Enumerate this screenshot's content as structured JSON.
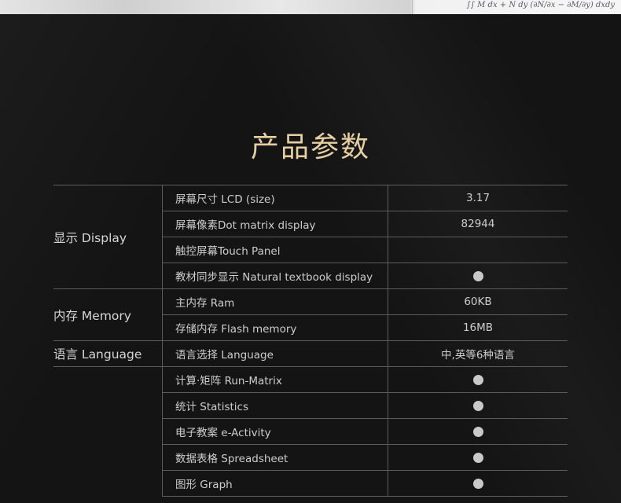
{
  "header_strip": {
    "scribble": "$\\frac{}{}M_{dx}+N dy \\int\\int(\\frac{\\partial N}{\\partial x}-\\frac{\\partial M}{\\partial y})dxdy$"
  },
  "page_title": "产品参数",
  "spec_table": {
    "groups": [
      {
        "category": "显示 Display",
        "rows": [
          {
            "name": "屏幕尺寸 LCD (size)",
            "value": "3.17",
            "dot": false
          },
          {
            "name": "屏幕像素Dot matrix display",
            "value": "82944",
            "dot": false
          },
          {
            "name": "触控屏幕Touch Panel",
            "value": "",
            "dot": false
          },
          {
            "name": "教材同步显示 Natural textbook display",
            "value": "",
            "dot": true
          }
        ]
      },
      {
        "category": "内存 Memory",
        "rows": [
          {
            "name": "主内存 Ram",
            "value": "60KB",
            "dot": false
          },
          {
            "name": "存储内存 Flash  memory",
            "value": "16MB",
            "dot": false
          }
        ]
      },
      {
        "category": "语言 Language",
        "rows": [
          {
            "name": "语言选择 Language",
            "value": "中,英等6种语言",
            "dot": false
          }
        ]
      },
      {
        "category": "",
        "rows": [
          {
            "name": "计算·矩阵 Run-Matrix",
            "value": "",
            "dot": true
          },
          {
            "name": "统计 Statistics",
            "value": "",
            "dot": true
          },
          {
            "name": "电子教案 e-Activity",
            "value": "",
            "dot": true
          },
          {
            "name": "数据表格 Spreadsheet",
            "value": "",
            "dot": true
          },
          {
            "name": "图形 Graph",
            "value": "",
            "dot": true
          }
        ]
      }
    ]
  }
}
